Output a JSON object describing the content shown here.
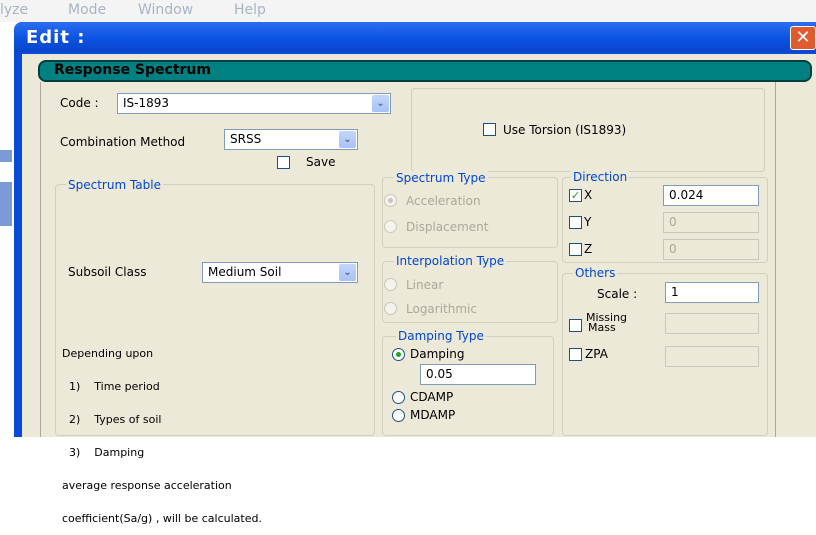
{
  "menu_bar": {
    "items": [
      "lyze",
      "Mode",
      "Window",
      "Help"
    ]
  },
  "window": {
    "title": "Edit :",
    "close_glyph": "✕"
  },
  "header": {
    "title": "Response Spectrum"
  },
  "code": {
    "label": "Code :",
    "value": "IS-1893"
  },
  "combination": {
    "label": "Combination Method",
    "value": "SRSS"
  },
  "save": {
    "label": "Save",
    "checked": false
  },
  "torsion": {
    "label": "Use Torsion (IS1893)",
    "checked": false
  },
  "spectrum_table": {
    "title": "Spectrum Table",
    "subsoil_label": "Subsoil Class",
    "subsoil_value": "Medium Soil",
    "note_lines": [
      "Depending upon",
      "  1)    Time period",
      "  2)    Types of soil",
      "  3)    Damping",
      "average response acceleration",
      "coefficient(Sa/g) , will be calculated."
    ]
  },
  "spectrum_type": {
    "title": "Spectrum Type",
    "acceleration": "Acceleration",
    "displacement": "Displacement",
    "selected": "Acceleration"
  },
  "interpolation_type": {
    "title": "Interpolation Type",
    "linear": "Linear",
    "logarithmic": "Logarithmic"
  },
  "damping_type": {
    "title": "Damping Type",
    "damping": "Damping",
    "damping_value": "0.05",
    "cdamp": "CDAMP",
    "mdamp": "MDAMP",
    "selected": "Damping"
  },
  "direction": {
    "title": "Direction",
    "x_label": "X",
    "x_value": "0.024",
    "x_checked": true,
    "y_label": "Y",
    "y_value": "0",
    "z_label": "Z",
    "z_value": "0"
  },
  "others": {
    "title": "Others",
    "scale_label": "Scale :",
    "scale_value": "1",
    "missing_label_1": "Missing",
    "missing_label_2": "Mass",
    "zpa_label": "ZPA"
  },
  "colors": {
    "title_bar": "#0a50e0",
    "header_teal": "#008080",
    "dialog_bg": "#ece9d8",
    "group_title": "#0046d5"
  }
}
